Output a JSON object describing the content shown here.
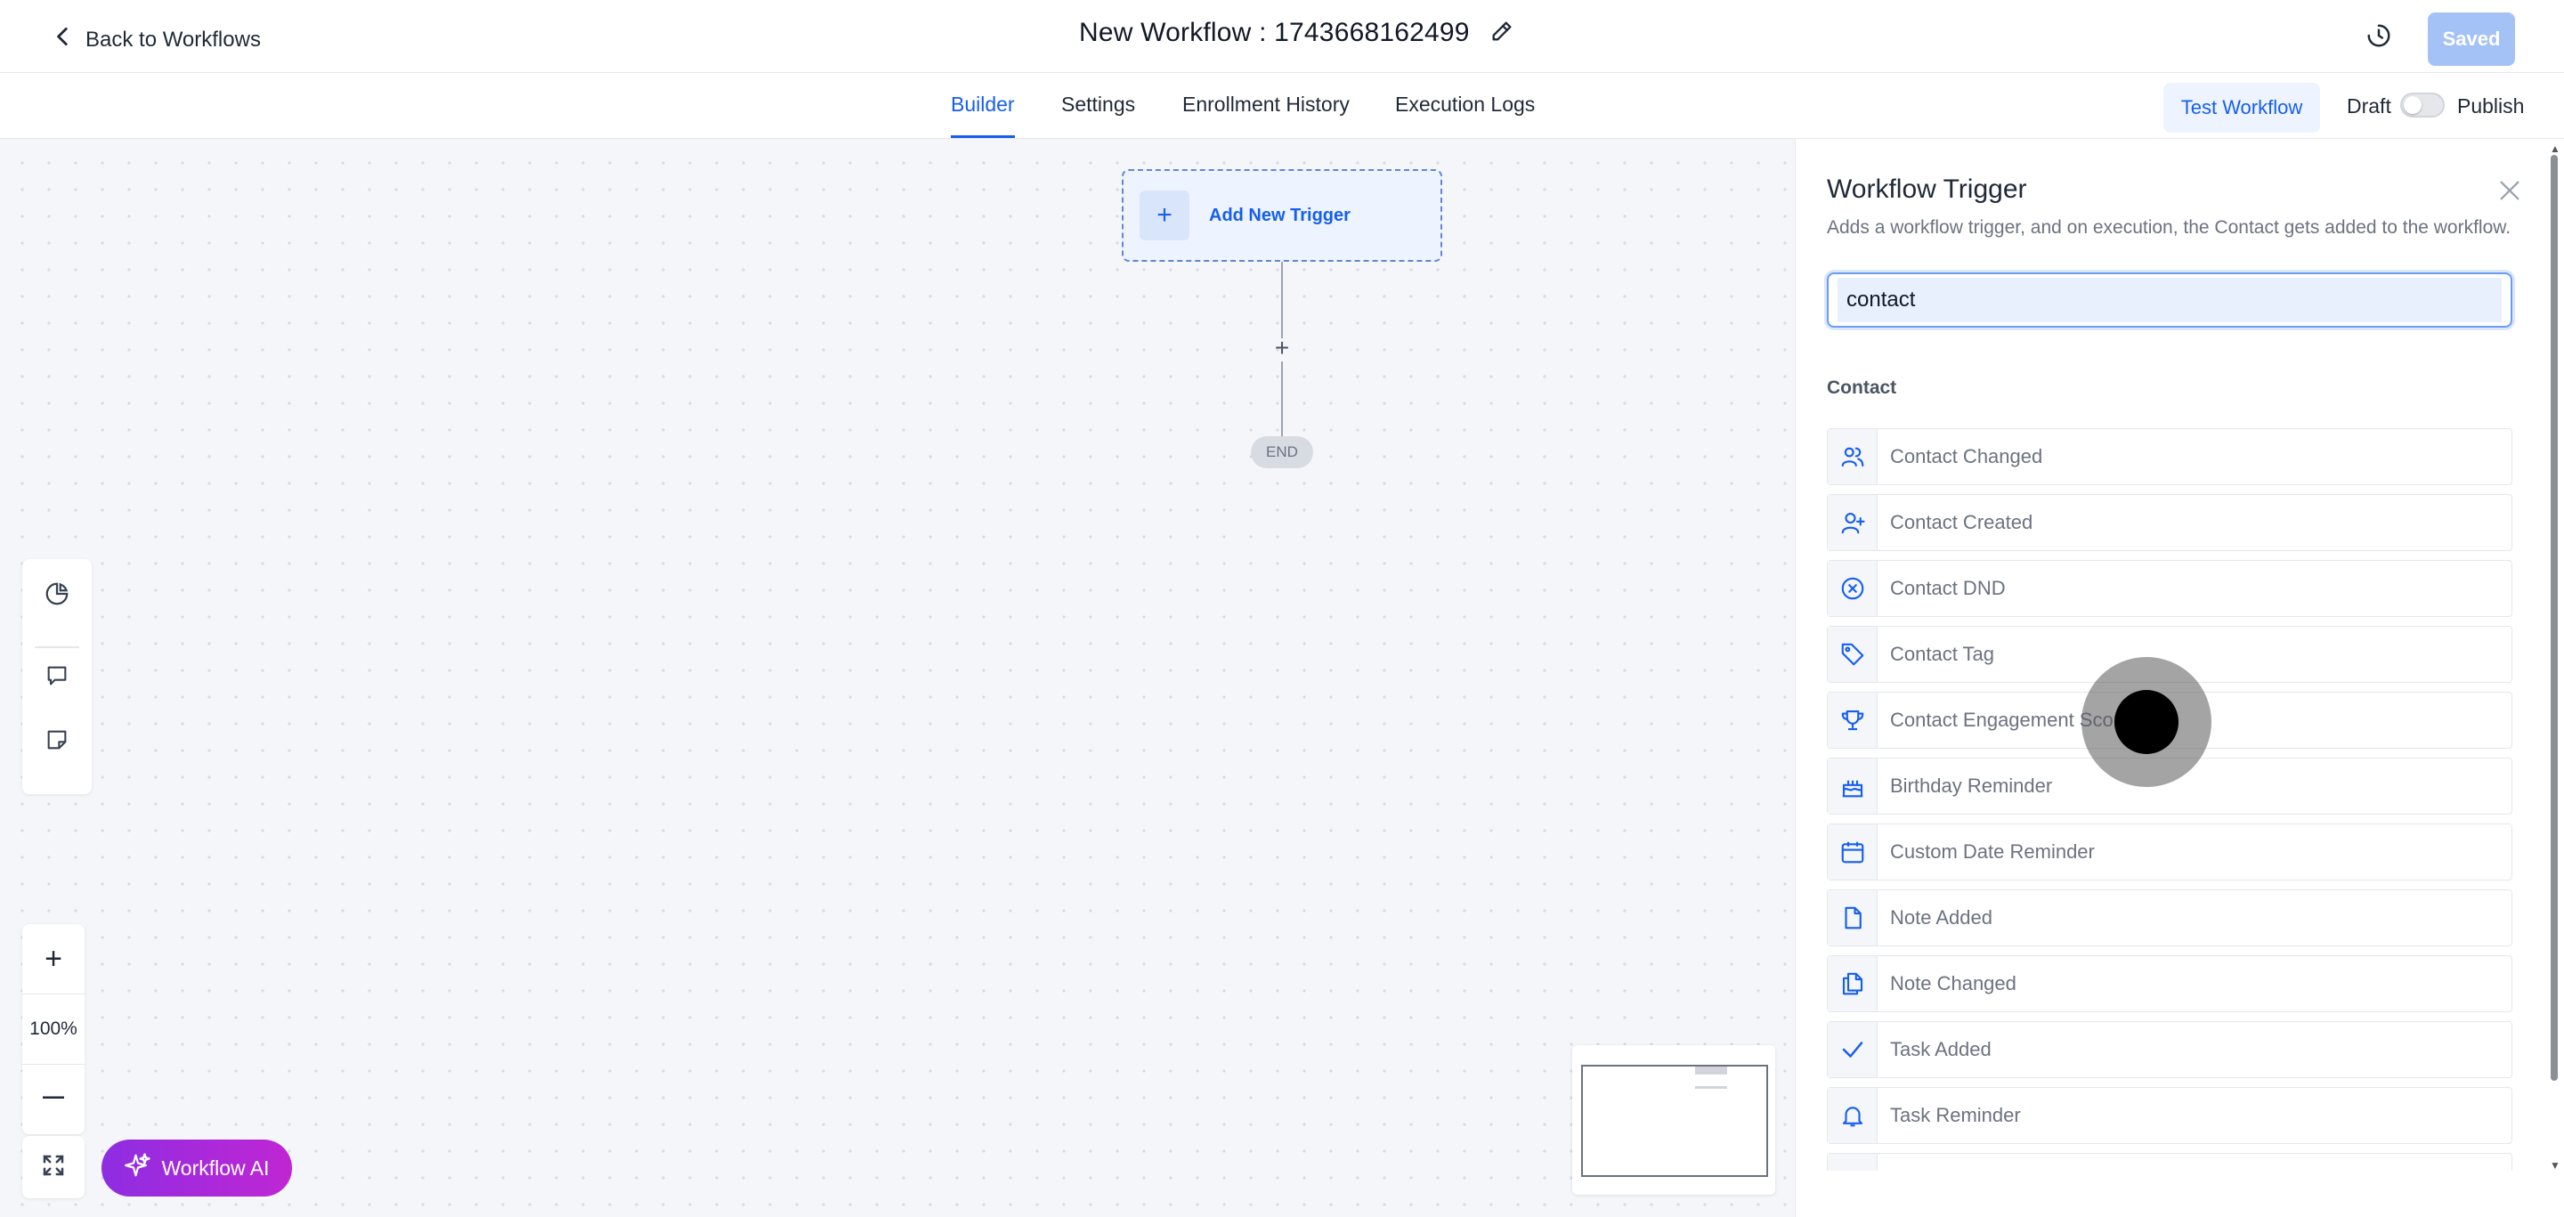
{
  "header": {
    "back_label": "Back to Workflows",
    "title": "New Workflow : 1743668162499",
    "saved_label": "Saved"
  },
  "tabs": [
    {
      "label": "Builder",
      "active": true
    },
    {
      "label": "Settings",
      "active": false
    },
    {
      "label": "Enrollment History",
      "active": false
    },
    {
      "label": "Execution Logs",
      "active": false
    }
  ],
  "actions": {
    "test_label": "Test Workflow",
    "draft_label": "Draft",
    "publish_label": "Publish",
    "publish_toggle_on": false
  },
  "canvas": {
    "trigger_label": "Add New Trigger",
    "end_label": "END",
    "zoom": "100%",
    "ai_label": "Workflow AI"
  },
  "panel": {
    "title": "Workflow Trigger",
    "description": "Adds a workflow trigger, and on execution, the Contact gets added to the workflow.",
    "search_value": "contact",
    "group_label": "Contact",
    "items": [
      {
        "label": "Contact Changed",
        "icon": "users-icon"
      },
      {
        "label": "Contact Created",
        "icon": "user-plus-icon"
      },
      {
        "label": "Contact DND",
        "icon": "x-circle-icon"
      },
      {
        "label": "Contact Tag",
        "icon": "tag-icon"
      },
      {
        "label": "Contact Engagement Score",
        "icon": "trophy-icon"
      },
      {
        "label": "Birthday Reminder",
        "icon": "cake-icon"
      },
      {
        "label": "Custom Date Reminder",
        "icon": "calendar-icon"
      },
      {
        "label": "Note Added",
        "icon": "file-icon"
      },
      {
        "label": "Note Changed",
        "icon": "files-icon"
      },
      {
        "label": "Task Added",
        "icon": "check-icon"
      },
      {
        "label": "Task Reminder",
        "icon": "bell-icon"
      }
    ]
  },
  "colors": {
    "accent": "#155eef",
    "saved_bg": "#a5c2f6",
    "ai_gradient_start": "#8e2de2",
    "ai_gradient_end": "#c026d3"
  }
}
